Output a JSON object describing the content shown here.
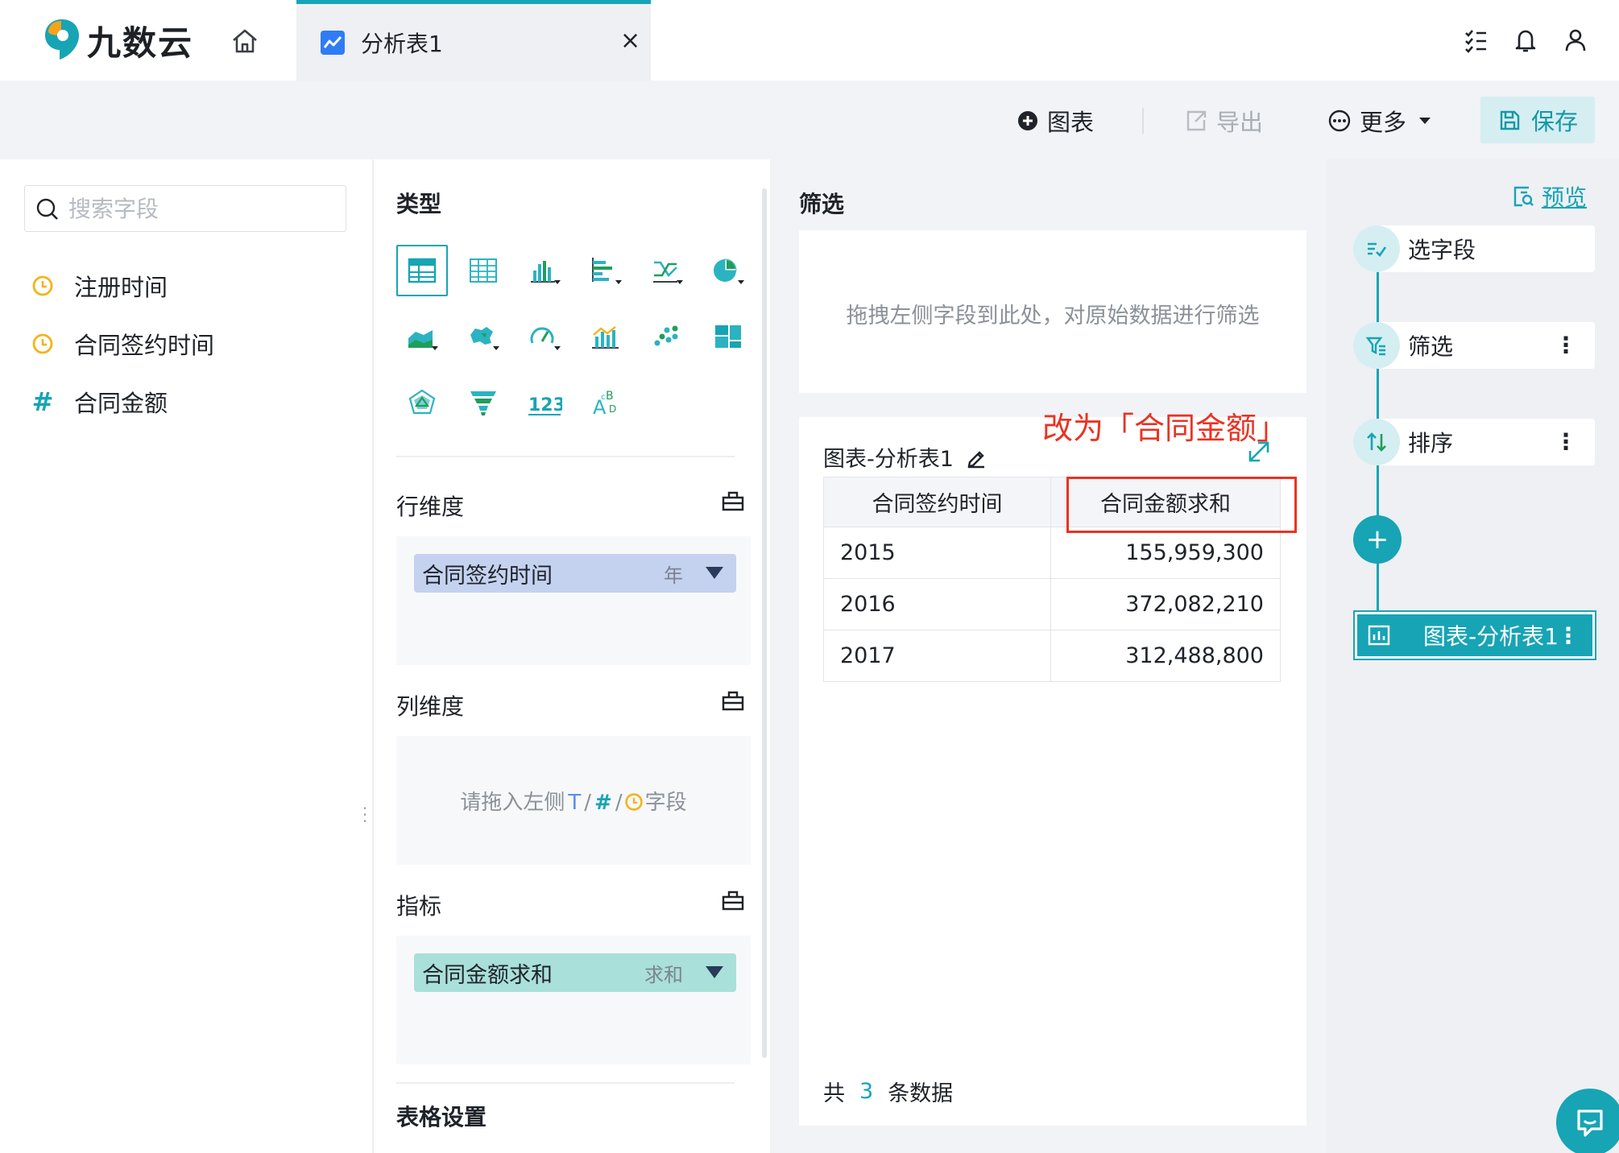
{
  "app": {
    "logo_text": "九数云"
  },
  "tab": {
    "label": "分析表1"
  },
  "toolbar": {
    "chart_label": "图表",
    "export_label": "导出",
    "more_label": "更多",
    "save_label": "保存"
  },
  "fields": {
    "search_placeholder": "搜索字段",
    "items": [
      {
        "label": "注册时间",
        "type": "time"
      },
      {
        "label": "合同签约时间",
        "type": "time"
      },
      {
        "label": "合同金额",
        "type": "number"
      }
    ]
  },
  "config": {
    "type_title": "类型",
    "row_dim_label": "行维度",
    "row_dim_pill": {
      "label": "合同签约时间",
      "agg": "年"
    },
    "col_dim_label": "列维度",
    "col_dim_hint_prefix": "请拖入左侧",
    "col_dim_hint_t": "T",
    "col_dim_hint_hash": "#",
    "col_dim_hint_suffix": "字段",
    "metric_label": "指标",
    "metric_pill": {
      "label": "合同金额求和",
      "agg": "求和"
    },
    "table_settings_label": "表格设置"
  },
  "main": {
    "filter_title": "筛选",
    "filter_hint": "拖拽左侧字段到此处，对原始数据进行筛选",
    "chart_title": "图表-分析表1",
    "annotation": "改为「合同金额」",
    "table": {
      "headers": [
        "合同签约时间",
        "合同金额求和"
      ],
      "rows": [
        [
          "2015",
          "155,959,300"
        ],
        [
          "2016",
          "372,082,210"
        ],
        [
          "2017",
          "312,488,800"
        ]
      ]
    },
    "row_count_prefix": "共",
    "row_count": "3",
    "row_count_suffix": "条数据"
  },
  "flow": {
    "preview_label": "预览",
    "steps": [
      "选字段",
      "筛选",
      "排序"
    ],
    "chart_step": "图表-分析表1"
  },
  "colors": {
    "accent": "#17a4b5",
    "annotation": "#ea3323",
    "time_icon": "#f5b31c",
    "number_icon": "#17a4b5"
  }
}
